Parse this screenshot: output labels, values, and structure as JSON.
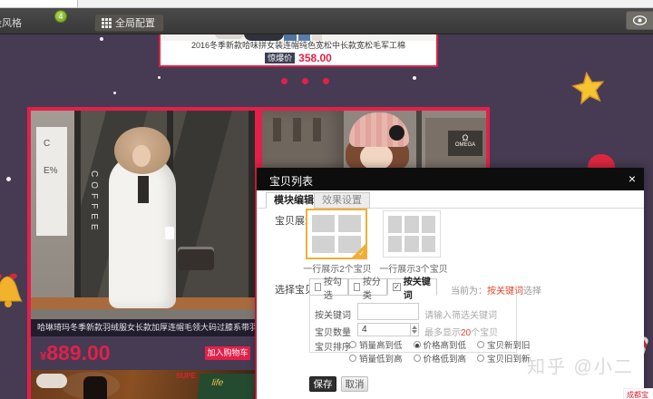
{
  "toolbar": {
    "style_label": "设风格",
    "style_badge": "4",
    "global_config_label": "全局配置"
  },
  "carousel_card": {
    "title": "2016冬季新款哈味拼女装连帽纯色宽松中长款宽松毛军工棉",
    "price_badge": "惊爆价",
    "price": "358.00"
  },
  "left_product": {
    "poster_line1": "C",
    "poster_line2": "E%",
    "coffee_sign": "COFFEE",
    "title": "哈琳琦玛冬季新款羽绒服女长款加厚连帽毛领大码过膝系带羽绒外套",
    "currency": "¥",
    "price": "889.00",
    "cart_button": "加入购物车",
    "red_sign": "SUPE",
    "flag_text": "life"
  },
  "right_product": {
    "omega_logo": "Ω",
    "omega_text": "OMEGA"
  },
  "modal": {
    "title": "宝贝列表",
    "close": "×",
    "tabs": [
      {
        "label": "模块编辑",
        "active": true
      },
      {
        "label": "效果设置",
        "active": false
      }
    ],
    "display_section": {
      "label": "宝贝展示",
      "check": "✓",
      "options": [
        {
          "caption": "一行展示2个宝贝",
          "selected": true,
          "grid": "2x2"
        },
        {
          "caption": "一行展示3个宝贝",
          "selected": false,
          "grid": "3x2"
        }
      ]
    },
    "select_section": {
      "label": "选择宝贝",
      "modes": [
        {
          "label": "按勾选",
          "checked": false
        },
        {
          "label": "按分类",
          "checked": false
        },
        {
          "label": "按关键词",
          "checked": true,
          "check_mark": "✓"
        }
      ],
      "current_prefix": "当前为：",
      "current_highlight": "按关键词",
      "current_suffix": "选择",
      "keyword_label": "按关键词",
      "keyword_hint": "请输入筛选关键词",
      "count_label": "宝贝数量",
      "count_value": "4",
      "count_hint_pre": "最多显示",
      "count_hint_num": "20",
      "count_hint_post": "个宝贝",
      "sort_label": "宝贝排序",
      "sort_options": [
        [
          {
            "label": "销量高到低",
            "selected": false
          },
          {
            "label": "价格高到低",
            "selected": true
          },
          {
            "label": "宝贝新到旧",
            "selected": false
          }
        ],
        [
          {
            "label": "销量低到高",
            "selected": false
          },
          {
            "label": "价格低到高",
            "selected": false
          },
          {
            "label": "宝贝旧到新",
            "selected": false
          }
        ]
      ],
      "save_label": "保存",
      "cancel_label": "取消"
    }
  },
  "watermark": "知乎 @小二",
  "corner_badge": "成都宝",
  "colors": {
    "page_background": "#463B52",
    "accent_red": "#E2204A",
    "selection_yellow": "#F0AE35",
    "badge_green": "#7FA832",
    "modal_header": "#0D0D0D",
    "price_badge_bg": "#3A3F52",
    "highlight_orange": "#E0452C"
  }
}
